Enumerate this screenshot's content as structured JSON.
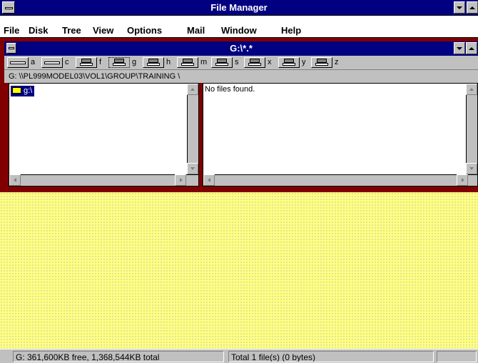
{
  "window": {
    "title": "File Manager"
  },
  "menu": {
    "items": [
      "File",
      "Disk",
      "Tree",
      "View",
      "Options",
      "Mail",
      "Window",
      "Help"
    ]
  },
  "child": {
    "title": "G:\\*.*",
    "drives": [
      "a",
      "c",
      "f",
      "g",
      "h",
      "m",
      "s",
      "x",
      "y",
      "z"
    ],
    "selected_drive": "g",
    "path": "G: \\\\PL999MODEL03\\VOL1\\GROUP\\TRAINING  \\",
    "tree_item": "g:\\",
    "file_list_message": "No files found."
  },
  "status": {
    "left": "G: 361,600KB free,  1,368,544KB total",
    "right": "Total 1 file(s) (0 bytes)"
  },
  "icons": [
    "system-menu-icon",
    "minimize-icon",
    "maximize-icon",
    "floppy-drive-icon",
    "hard-drive-icon",
    "network-drive-icon",
    "folder-icon",
    "scroll-up-icon",
    "scroll-down-icon",
    "scroll-left-icon",
    "scroll-right-icon"
  ],
  "colors": {
    "titlebar": "#000080",
    "selection": "#000080",
    "frame": "#800000",
    "workspace": "#ffff80",
    "face": "#c0c0c0"
  }
}
